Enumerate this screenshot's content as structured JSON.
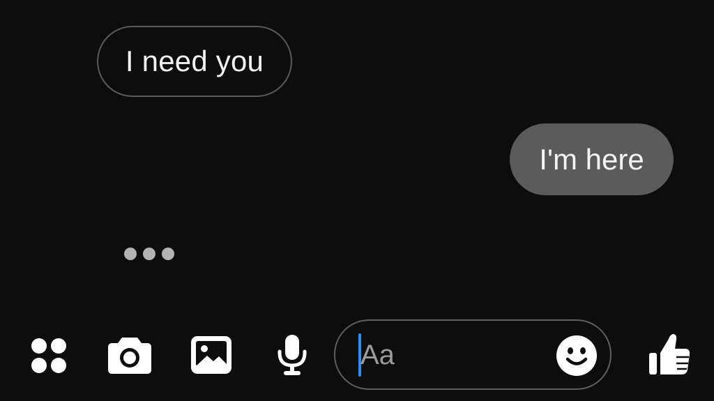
{
  "conversation": {
    "incoming": [
      {
        "text": "I need you"
      }
    ],
    "outgoing": [
      {
        "text": "I'm here"
      }
    ],
    "typing_indicator": {
      "visible": true,
      "dots": 3
    }
  },
  "toolbar": {
    "icons": [
      "apps-grid-icon",
      "camera-icon",
      "image-icon",
      "microphone-icon",
      "emoji-icon",
      "thumbs-up-icon"
    ]
  },
  "composer": {
    "placeholder": "Aa",
    "value": ""
  },
  "colors": {
    "background": "#0d0d0e",
    "incoming_bubble_border": "#5a5a5c",
    "outgoing_bubble": "#5b5b5b",
    "caret": "#2f8bff",
    "icon": "#ffffff"
  }
}
